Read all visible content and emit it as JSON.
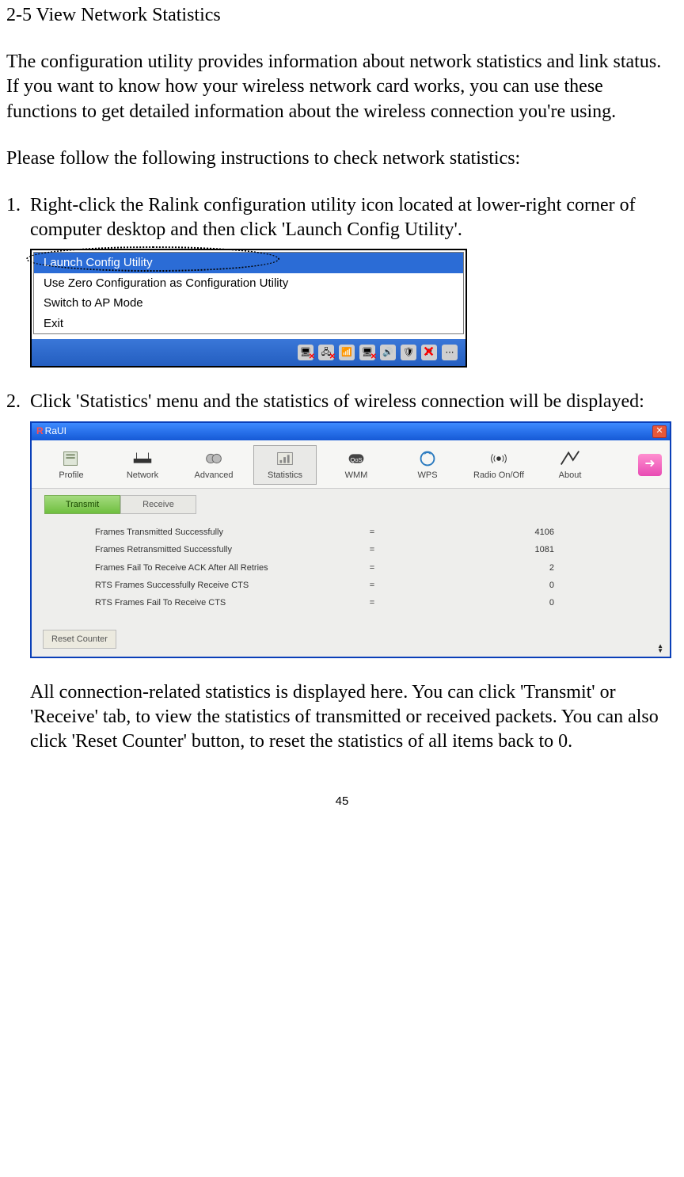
{
  "heading": "2-5 View Network Statistics",
  "intro": "The configuration utility provides information about network statistics and link status. If you want to know how your wireless network card works, you can use these functions to get detailed information about the wireless connection you're using.",
  "instructions_lead": "Please follow the following instructions to check network statistics:",
  "step1_num": "1.",
  "step1_text": "Right-click the Ralink configuration utility icon located at lower-right corner of computer desktop and then click 'Launch Config Utility'.",
  "step2_num": "2.",
  "step2_text": "Click 'Statistics' menu and the statistics of wireless connection will be displayed:",
  "after_text": "All connection-related statistics is displayed here. You can click 'Transmit' or 'Receive' tab, to view the statistics of transmitted or received packets. You can also click 'Reset Counter' button, to reset the statistics of all items back to 0.",
  "page_number": "45",
  "ss1": {
    "items": [
      "Launch Config Utility",
      "Use Zero Configuration as Configuration Utility",
      "Switch to AP Mode",
      "Exit"
    ]
  },
  "ss2": {
    "title": "RaUI",
    "toolbar": [
      "Profile",
      "Network",
      "Advanced",
      "Statistics",
      "WMM",
      "WPS",
      "Radio On/Off",
      "About"
    ],
    "subtabs": [
      "Transmit",
      "Receive"
    ],
    "rows": [
      {
        "k": "Frames Transmitted Successfully",
        "v": "4106"
      },
      {
        "k": "Frames Retransmitted Successfully",
        "v": "1081"
      },
      {
        "k": "Frames Fail To Receive ACK After All Retries",
        "v": "2"
      },
      {
        "k": "RTS Frames Successfully Receive CTS",
        "v": "0"
      },
      {
        "k": "RTS Frames Fail To Receive CTS",
        "v": "0"
      }
    ],
    "reset": "Reset Counter"
  }
}
